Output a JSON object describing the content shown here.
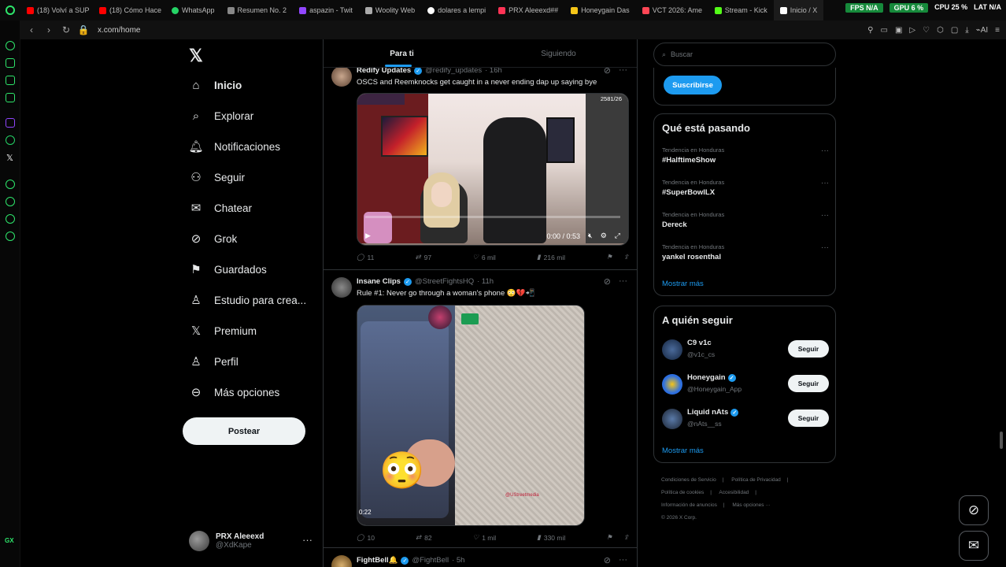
{
  "browser": {
    "tabs": [
      {
        "label": "(18) Volví a SUP",
        "color": "#ff0000"
      },
      {
        "label": "(18) Cómo Hace",
        "color": "#ff0000"
      },
      {
        "label": "WhatsApp",
        "color": "#25d366"
      },
      {
        "label": "Resumen No. 2",
        "color": "#888888"
      },
      {
        "label": "aspazin - Twit",
        "color": "#9146ff"
      },
      {
        "label": "Woolity Web",
        "color": "#aaaaaa"
      },
      {
        "label": "dolares a lempi",
        "color": "#ffffff"
      },
      {
        "label": "PRX Aleeexd##",
        "color": "#ff3355"
      },
      {
        "label": "Honeygain Das",
        "color": "#f5c518"
      },
      {
        "label": "VCT 2026: Ame",
        "color": "#ff4655"
      },
      {
        "label": "Stream - Kick",
        "color": "#53fc18"
      },
      {
        "label": "Inicio / X",
        "color": "#ffffff"
      }
    ],
    "hud": {
      "fps": "FPS N/A",
      "gpu": "GPU 6 %",
      "cpu": "CPU 25 %",
      "lat": "LAT N/A"
    },
    "url": "x.com/home",
    "accent": "#2ee66b"
  },
  "nav": {
    "logo": "𝕏",
    "items": [
      {
        "label": "Inicio",
        "icon": "home-icon",
        "glyph": "⌂"
      },
      {
        "label": "Explorar",
        "icon": "search-icon",
        "glyph": "⌕"
      },
      {
        "label": "Notificaciones",
        "icon": "bell-icon",
        "glyph": "♫"
      },
      {
        "label": "Seguir",
        "icon": "follow-icon",
        "glyph": "⚇"
      },
      {
        "label": "Chatear",
        "icon": "mail-icon",
        "glyph": "✉"
      },
      {
        "label": "Grok",
        "icon": "grok-icon",
        "glyph": "⊘"
      },
      {
        "label": "Guardados",
        "icon": "bookmark-icon",
        "glyph": "⚑"
      },
      {
        "label": "Estudio para crea...",
        "icon": "studio-icon",
        "glyph": "♙"
      },
      {
        "label": "Premium",
        "icon": "x-premium-icon",
        "glyph": "𝕏"
      },
      {
        "label": "Perfil",
        "icon": "profile-icon",
        "glyph": "♙"
      },
      {
        "label": "Más opciones",
        "icon": "more-options-icon",
        "glyph": "⊖"
      }
    ],
    "post_label": "Postear",
    "account": {
      "name": "PRX Aleeexd",
      "handle": "@XdKape",
      "more": "···"
    }
  },
  "timeline": {
    "tabs": [
      "Para ti",
      "Siguiendo"
    ],
    "tweets": [
      {
        "name": "Redify Updates",
        "handle": "@redify_updates",
        "time": "· 16h",
        "text": "OSCS and Reemknocks get caught in a never ending dap up saying bye",
        "media_time": "0:00 / 0:53",
        "media_count": "2581/26",
        "stats": {
          "replies": "11",
          "reposts": "97",
          "likes": "6 mil",
          "views": "216 mil"
        }
      },
      {
        "name": "Insane Clips",
        "handle": "@StreetFightsHQ",
        "time": "· 11h",
        "text": "Rule #1: Never go through a woman's phone 😳💔📲",
        "media_time": "0:22",
        "media_watermark": "@UStreetmedia",
        "stats": {
          "replies": "10",
          "reposts": "82",
          "likes": "1 mil",
          "views": "330 mil"
        }
      },
      {
        "name": "FightBell🔔",
        "handle": "@FightBell",
        "time": "· 5h"
      }
    ]
  },
  "sidebar": {
    "search_placeholder": "Buscar",
    "subscribe_label": "Suscribirse",
    "trending_title": "Qué está pasando",
    "trends": [
      {
        "context": "Tendencia en Honduras",
        "name": "#HalftimeShow"
      },
      {
        "context": "Tendencia en Honduras",
        "name": "#SuperBowlLX"
      },
      {
        "context": "Tendencia en Honduras",
        "name": "Dereck"
      },
      {
        "context": "Tendencia en Honduras",
        "name": "yankel rosenthal"
      }
    ],
    "show_more": "Mostrar más",
    "who_to_follow_title": "A quién seguir",
    "follow_suggestions": [
      {
        "name": "C9 v1c",
        "handle": "@v1c_cs",
        "verified": false,
        "button": "Seguir"
      },
      {
        "name": "Honeygain",
        "handle": "@Honeygain_App",
        "verified": true,
        "button": "Seguir"
      },
      {
        "name": "Liquid nAts",
        "handle": "@nAts__ss",
        "verified": true,
        "button": "Seguir"
      }
    ],
    "footer_links": [
      "Condiciones de Servicio",
      "Política de Privacidad",
      "Política de cookies",
      "Accesibilidad",
      "Información de anuncios",
      "Más opciones ···",
      "© 2026 X Corp."
    ]
  }
}
